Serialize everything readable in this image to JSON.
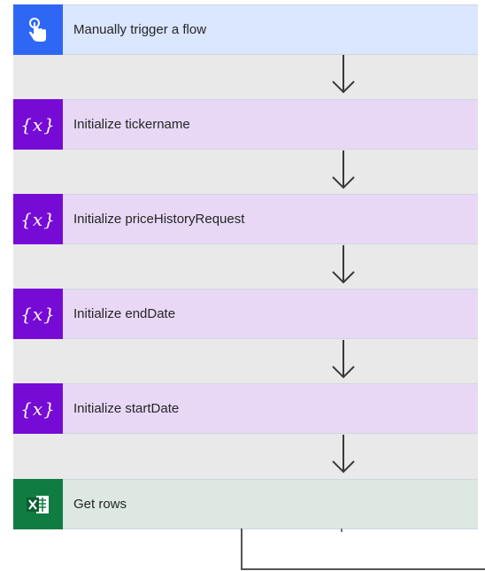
{
  "steps": [
    {
      "label": "Manually trigger a flow",
      "kind": "trigger",
      "icon": "touch-hand-icon"
    },
    {
      "label": "Initialize tickername",
      "kind": "variable",
      "icon": "variable-icon",
      "icon_text": "{x}"
    },
    {
      "label": "Initialize priceHistoryRequest",
      "kind": "variable",
      "icon": "variable-icon",
      "icon_text": "{x}"
    },
    {
      "label": "Initialize endDate",
      "kind": "variable",
      "icon": "variable-icon",
      "icon_text": "{x}"
    },
    {
      "label": "Initialize startDate",
      "kind": "variable",
      "icon": "variable-icon",
      "icon_text": "{x}"
    },
    {
      "label": "Get rows",
      "kind": "excel",
      "icon": "excel-icon"
    }
  ],
  "colors": {
    "trigger_accent": "#2f67f5",
    "variable_accent": "#770bd6",
    "excel_accent": "#107c41",
    "canvas": "#e9e9e9"
  }
}
